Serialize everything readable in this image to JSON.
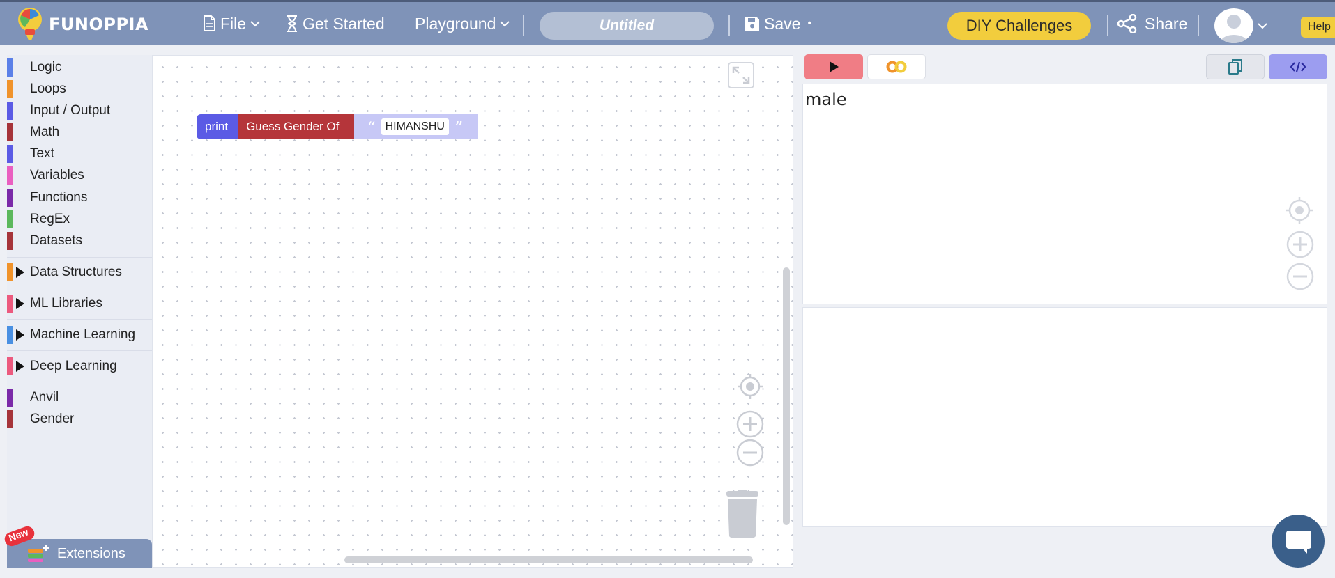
{
  "app": {
    "name": "FUNOPPIA"
  },
  "nav": {
    "file": "File",
    "get_started": "Get Started",
    "playground": "Playground",
    "project_title": "Untitled",
    "save": "Save",
    "save_dot": "•",
    "diy": "DIY Challenges",
    "share": "Share",
    "help": "Help"
  },
  "sidebar": {
    "categories": [
      {
        "label": "Logic",
        "color": "#5b80e8"
      },
      {
        "label": "Loops",
        "color": "#f0932b"
      },
      {
        "label": "Input / Output",
        "color": "#5b5be5"
      },
      {
        "label": "Math",
        "color": "#a6343a"
      },
      {
        "label": "Text",
        "color": "#5b5be5"
      },
      {
        "label": "Variables",
        "color": "#ea5fc0"
      },
      {
        "label": "Functions",
        "color": "#7b2aa8"
      },
      {
        "label": "RegEx",
        "color": "#5cb85c"
      },
      {
        "label": "Datasets",
        "color": "#a6343a"
      }
    ],
    "groups": [
      {
        "label": "Data Structures",
        "color": "#f0932b"
      },
      {
        "label": "ML Libraries",
        "color": "#ec5a7e"
      },
      {
        "label": "Machine Learning",
        "color": "#4a90e2"
      },
      {
        "label": "Deep Learning",
        "color": "#ec5a7e"
      }
    ],
    "extras": [
      {
        "label": "Anvil",
        "color": "#7b2aa8"
      },
      {
        "label": "Gender",
        "color": "#a6343a"
      }
    ],
    "extensions": "Extensions",
    "new_badge": "New"
  },
  "workspace": {
    "blocks": {
      "print": "print",
      "guess": "Guess Gender Of",
      "string_value": "HIMANSHU",
      "open_quote": "“",
      "close_quote": "”"
    }
  },
  "output": {
    "text": "male"
  },
  "colors": {
    "topbar": "#7f93b8",
    "accent_yellow": "#f2cd3d",
    "run": "#f07d85",
    "code": "#9c9df0"
  }
}
